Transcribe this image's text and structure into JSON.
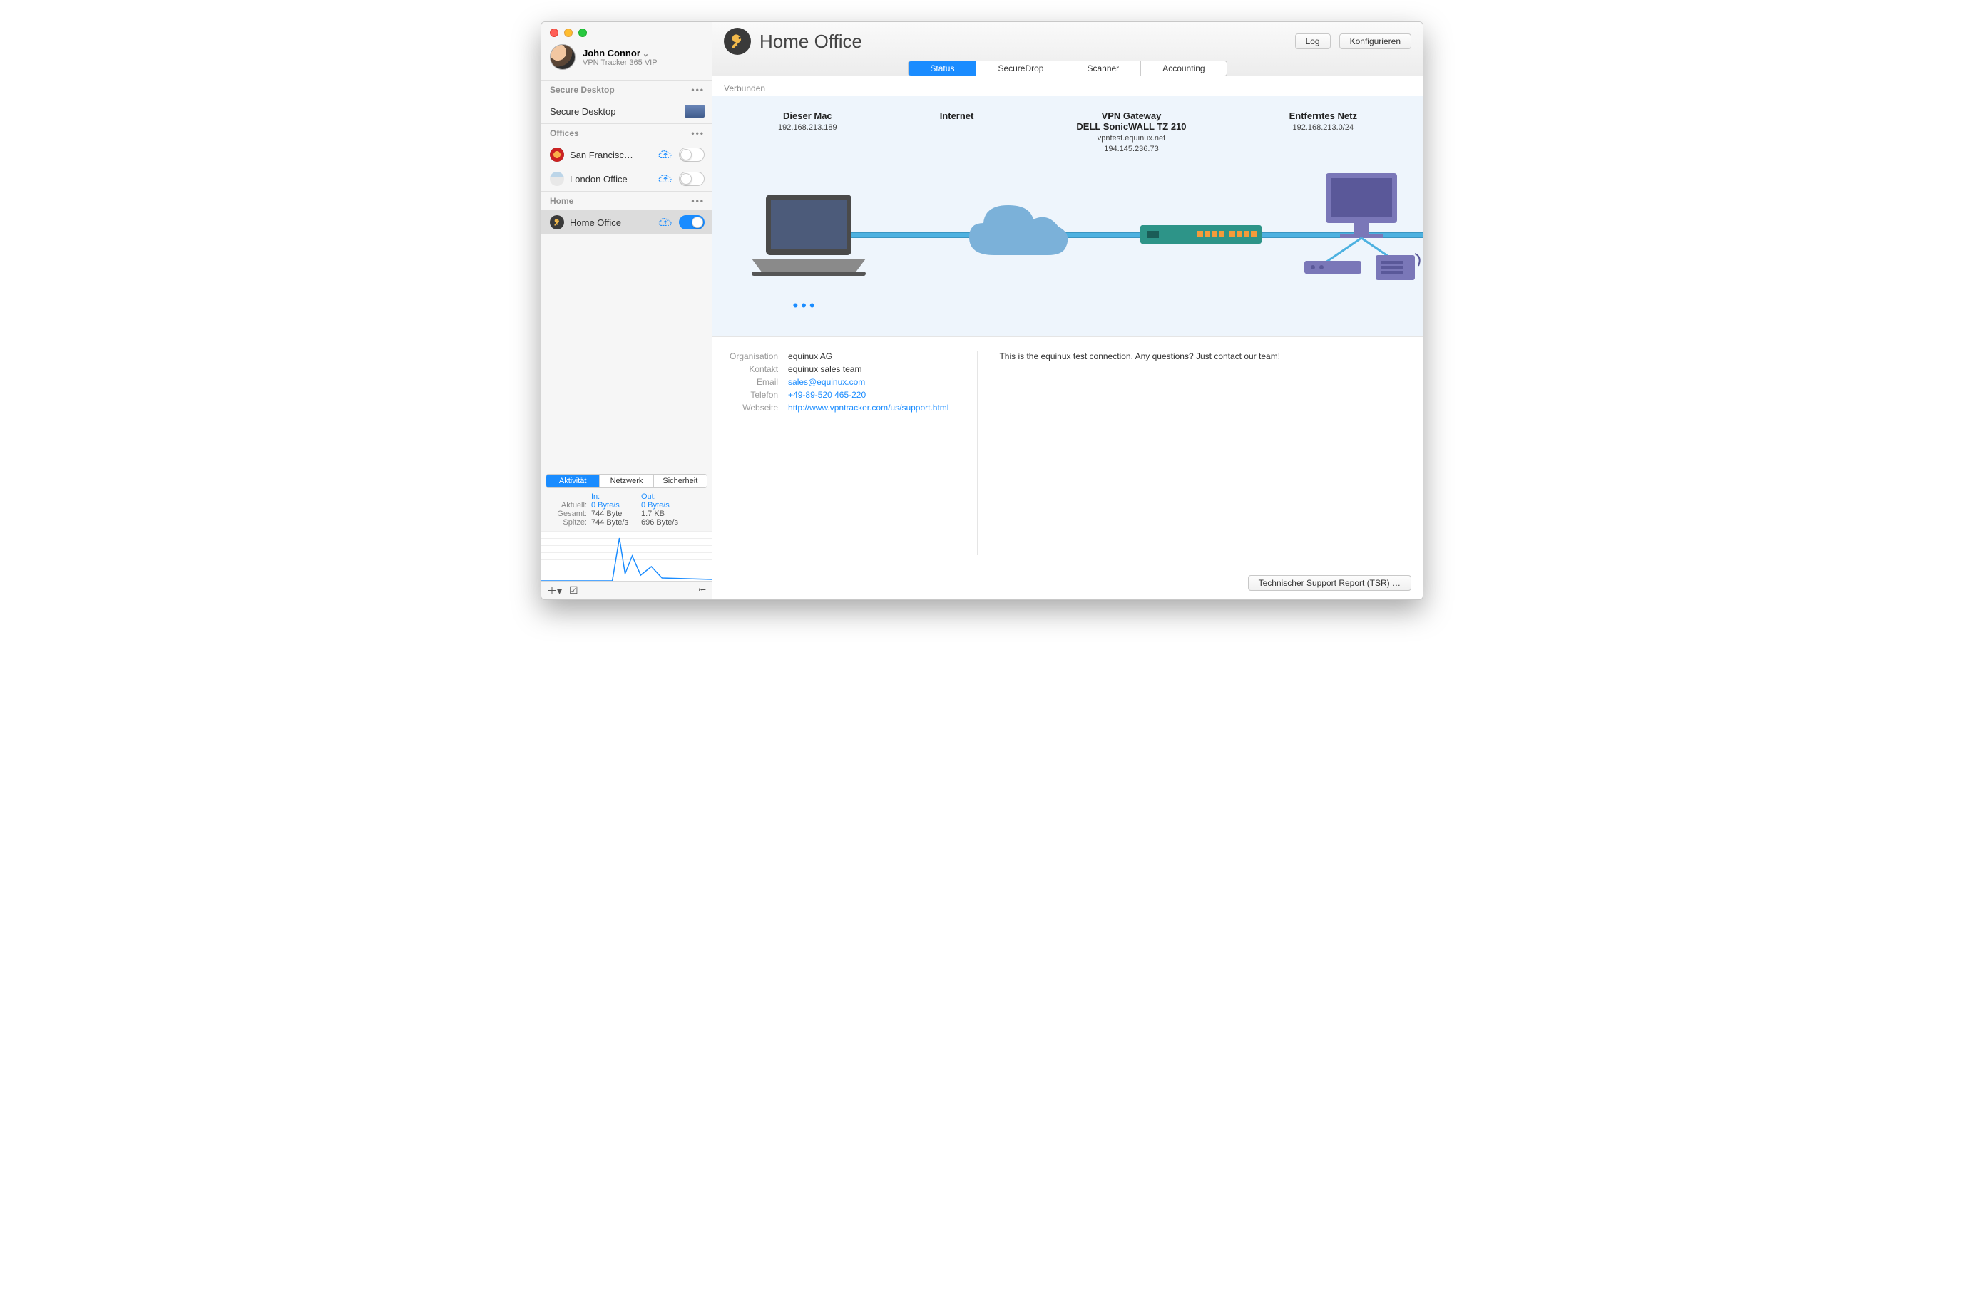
{
  "user": {
    "name": "John Connor",
    "subtitle": "VPN Tracker 365 VIP"
  },
  "header": {
    "title": "Home Office",
    "log_button": "Log",
    "configure_button": "Konfigurieren",
    "tabs": [
      "Status",
      "SecureDrop",
      "Scanner",
      "Accounting"
    ]
  },
  "sidebar": {
    "sections": {
      "secure_desktop": {
        "header": "Secure Desktop",
        "item": "Secure Desktop"
      },
      "offices": {
        "header": "Offices",
        "items": [
          {
            "label": "San Francisc…"
          },
          {
            "label": "London Office"
          }
        ]
      },
      "home": {
        "header": "Home",
        "items": [
          {
            "label": "Home Office"
          }
        ]
      }
    },
    "activity": {
      "tabs": [
        "Aktivität",
        "Netzwerk",
        "Sicherheit"
      ],
      "head_in": "In:",
      "head_out": "Out:",
      "rows": [
        {
          "label": "Aktuell:",
          "in": "0 Byte/s",
          "out": "0 Byte/s"
        },
        {
          "label": "Gesamt:",
          "in": "744 Byte",
          "out": "1.7 KB"
        },
        {
          "label": "Spitze:",
          "in": "744 Byte/s",
          "out": "696 Byte/s"
        }
      ]
    }
  },
  "status": {
    "label": "Verbunden",
    "nodes": {
      "this_mac": {
        "title": "Dieser Mac",
        "ip": "192.168.213.189"
      },
      "internet": {
        "title": "Internet"
      },
      "gateway": {
        "title": "VPN Gateway",
        "model": "DELL SonicWALL TZ 210",
        "host": "vpntest.equinux.net",
        "ip": "194.145.236.73"
      },
      "remote": {
        "title": "Entferntes Netz",
        "subnet": "192.168.213.0/24"
      }
    }
  },
  "info": {
    "labels": {
      "organisation": "Organisation",
      "kontakt": "Kontakt",
      "email": "Email",
      "telefon": "Telefon",
      "webseite": "Webseite"
    },
    "values": {
      "organisation": "equinux AG",
      "kontakt": "equinux sales team",
      "email": "sales@equinux.com",
      "telefon": "+49-89-520 465-220",
      "webseite": "http://www.vpntracker.com/us/support.html"
    },
    "note": "This is the equinux test connection. Any questions? Just contact our team!"
  },
  "footer": {
    "tsr_button": "Technischer Support Report (TSR) …"
  }
}
